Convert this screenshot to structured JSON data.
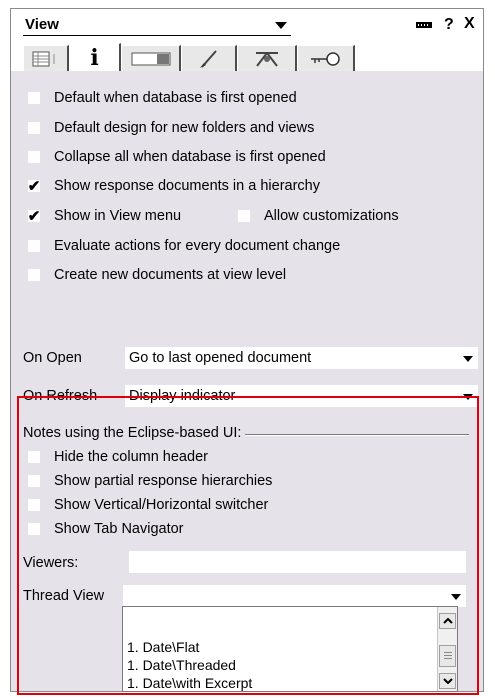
{
  "header": {
    "title": "View"
  },
  "tabs": [
    {
      "icon": "grid-icon",
      "active": false
    },
    {
      "icon": "info-icon",
      "label": "i",
      "active": true
    },
    {
      "icon": "bar-icon",
      "active": false
    },
    {
      "icon": "brush-icon",
      "active": false
    },
    {
      "icon": "hierarchy-icon",
      "active": false
    },
    {
      "icon": "key-icon",
      "active": false
    }
  ],
  "options": [
    {
      "label": "Default when database is first opened",
      "checked": false,
      "mark": ""
    },
    {
      "label": "Default design for new folders and views",
      "checked": false,
      "mark": ""
    },
    {
      "label": "Collapse all when database is first opened",
      "checked": false,
      "mark": ""
    },
    {
      "label": "Show response documents in a hierarchy",
      "checked": true,
      "mark": "✔"
    },
    {
      "label": "Show in View menu",
      "checked": true,
      "mark": "✔"
    },
    {
      "label": "Allow customizations",
      "checked": false,
      "mark": ""
    },
    {
      "label": "Evaluate actions for every document change",
      "checked": false,
      "mark": ""
    },
    {
      "label": "Create new documents at view level",
      "checked": false,
      "mark": ""
    }
  ],
  "on_open": {
    "label": "On Open",
    "value": "Go to last opened document"
  },
  "on_refresh": {
    "label": "On Refresh",
    "value": "Display indicator"
  },
  "eclipse": {
    "group_label": "Notes using the Eclipse-based UI:",
    "options": [
      {
        "label": "Hide the column header",
        "checked": false
      },
      {
        "label": "Show partial response hierarchies",
        "checked": false
      },
      {
        "label": "Show Vertical/Horizontal switcher",
        "checked": false
      },
      {
        "label": "Show Tab Navigator",
        "checked": false
      }
    ],
    "viewers_label": "Viewers:",
    "viewers_value": "",
    "thread_view_label": "Thread View",
    "thread_view_value": "",
    "thread_view_options": [
      "1. Date\\Flat",
      "1. Date\\Threaded",
      "1. Date\\with Excerpt"
    ]
  },
  "colors": {
    "panel_bg": "#e6e2ea",
    "highlight": "#e0000b"
  }
}
